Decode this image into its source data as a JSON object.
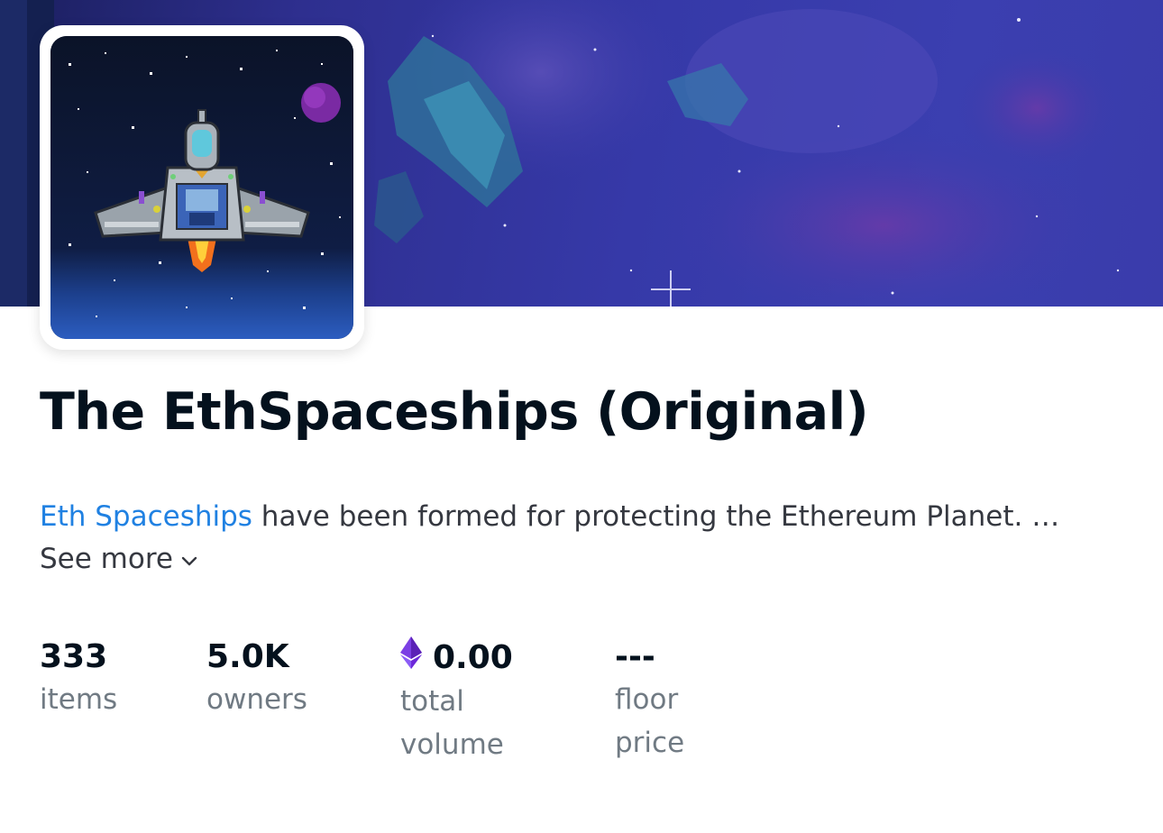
{
  "collection": {
    "title": "The EthSpaceships (Original)",
    "description_link": "Eth Spaceships",
    "description_rest": " have been formed for protecting the Ethereum Planet. …",
    "see_more_label": "See more"
  },
  "stats": [
    {
      "value": "333",
      "label": "items"
    },
    {
      "value": "5.0K",
      "label": "owners"
    },
    {
      "value": "0.00",
      "label": "total volume",
      "icon": "ethereum-icon"
    },
    {
      "value": "---",
      "label": "floor price"
    }
  ],
  "colors": {
    "link": "#2081e2",
    "text_primary": "#04111d",
    "text_secondary": "#707a83",
    "eth_purple": "#7b3fe4"
  }
}
